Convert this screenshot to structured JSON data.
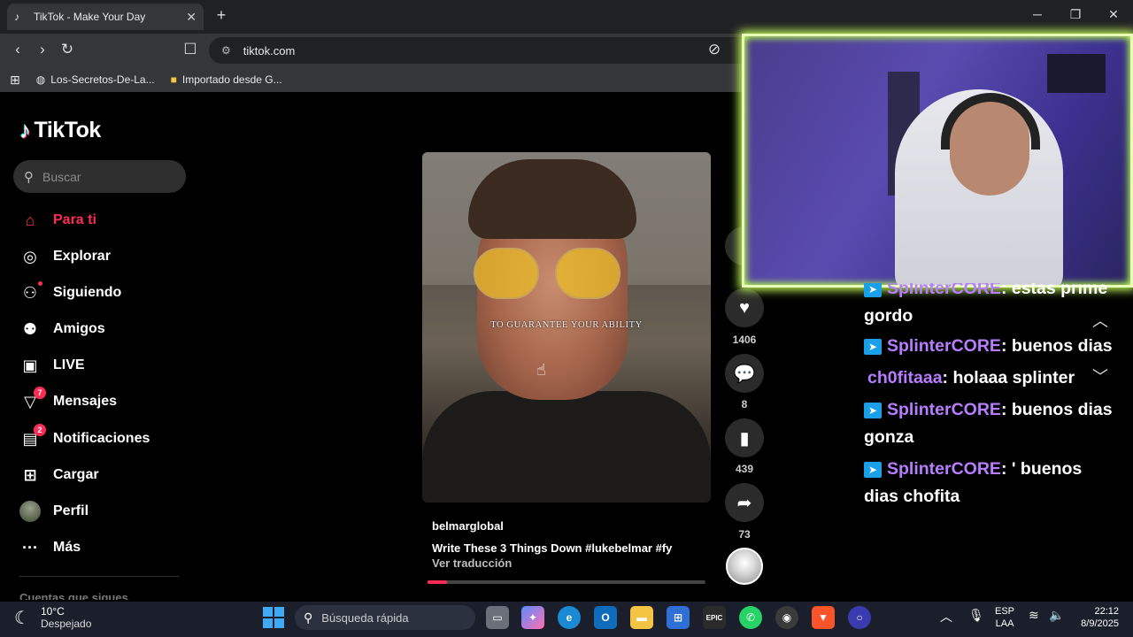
{
  "browser": {
    "tab_title": "TikTok - Make Your Day",
    "tab_close": "✕",
    "new_tab": "+",
    "url": "tiktok.com",
    "bookmarks": [
      {
        "label": "Los-Secretos-De-La...",
        "icon": "globe-icon"
      },
      {
        "label": "Importado desde G...",
        "icon": "folder-icon"
      }
    ]
  },
  "tiktok": {
    "logo": "TikTok",
    "search_placeholder": "Buscar",
    "nav": [
      {
        "label": "Para ti",
        "icon": "home-icon",
        "active": true
      },
      {
        "label": "Explorar",
        "icon": "compass-icon"
      },
      {
        "label": "Siguiendo",
        "icon": "following-icon"
      },
      {
        "label": "Amigos",
        "icon": "friends-icon"
      },
      {
        "label": "LIVE",
        "icon": "live-icon"
      },
      {
        "label": "Mensajes",
        "icon": "messages-icon",
        "badge": "7"
      },
      {
        "label": "Notificaciones",
        "icon": "notifications-icon",
        "badge": "2"
      },
      {
        "label": "Cargar",
        "icon": "upload-icon"
      },
      {
        "label": "Perfil",
        "icon": "profile-avatar-icon"
      },
      {
        "label": "Más",
        "icon": "more-icon"
      }
    ],
    "following_header": "Cuentas que sigues",
    "video": {
      "overlay_text": "TO GUARANTEE YOUR ABILITY",
      "author": "belmarglobal",
      "description": "Write These 3 Things Down #lukebelmar  #fy",
      "translate": "Ver traducción",
      "progress": 0.07
    },
    "actions": [
      {
        "name": "like",
        "icon": "heart-icon",
        "count": "1406"
      },
      {
        "name": "comment",
        "icon": "comment-icon",
        "count": "8"
      },
      {
        "name": "bookmark",
        "icon": "bookmark-icon",
        "count": "439"
      },
      {
        "name": "share",
        "icon": "share-icon",
        "count": "73"
      }
    ]
  },
  "chat": [
    {
      "user": "SplinterCORE",
      "text": ": estas prime gordo",
      "badge": true
    },
    {
      "user": "SplinterCORE",
      "text": ": buenos dias",
      "badge": true
    },
    {
      "user": "ch0fitaaa",
      "text": ": holaaa splinter",
      "badge": false
    },
    {
      "user": "SplinterCORE",
      "text": ": buenos dias gonza",
      "badge": true
    },
    {
      "user": "SplinterCORE",
      "text": ": ' buenos dias chofita",
      "badge": true
    }
  ],
  "taskbar": {
    "temp": "10°C",
    "weather": "Despejado",
    "search_placeholder": "Búsqueda rápida",
    "lang_line1": "ESP",
    "lang_line2": "LAA",
    "time": "22:12",
    "date": "8/9/2025"
  },
  "colors": {
    "tiktok_accent": "#fe2c55",
    "chat_user": "#b87dff",
    "cam_border": "#c7ff5a"
  }
}
